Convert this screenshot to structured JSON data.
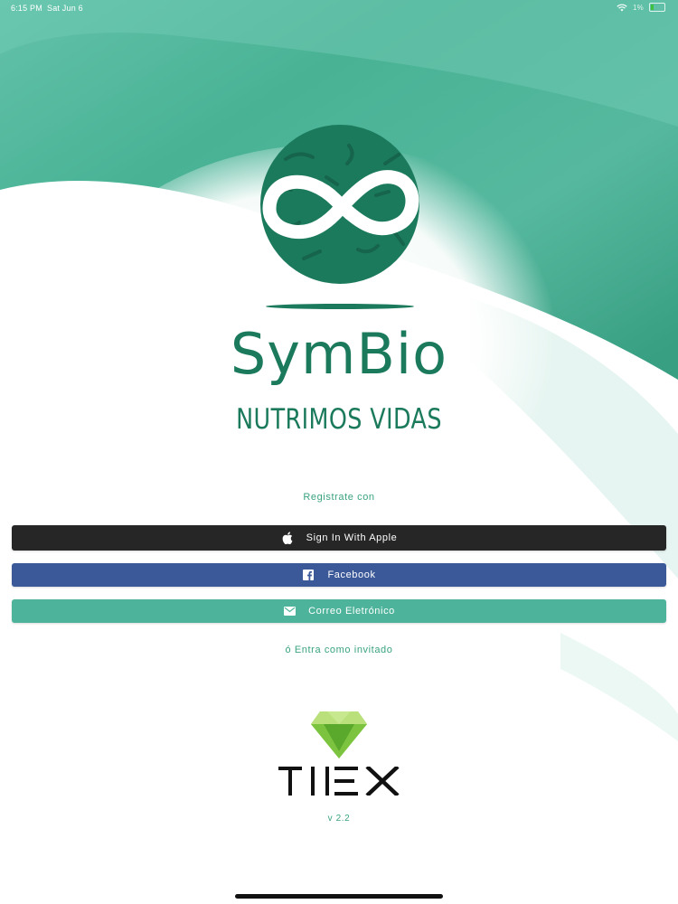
{
  "status_bar": {
    "time": "6:15 PM",
    "date": "Sat Jun 6",
    "battery_percent": "1%",
    "icons": [
      "wifi-icon",
      "battery-icon"
    ]
  },
  "brand": {
    "name": "SymBio",
    "tagline": "NUTRIMOS VIDAS",
    "logo_icon": "infinity-globe-icon"
  },
  "auth": {
    "register_label": "Registrate con",
    "buttons": [
      {
        "label": "Sign In With Apple",
        "icon": "apple-icon",
        "color": "#262626"
      },
      {
        "label": "Facebook",
        "icon": "facebook-icon",
        "color": "#3b5998"
      },
      {
        "label": "Correo Eletrónico",
        "icon": "mail-icon",
        "color": "#4db39a"
      }
    ],
    "guest_link": "ó Entra como invitado"
  },
  "footer": {
    "company": "TIEX",
    "gem_icon": "gem-icon",
    "version": "v 2.2"
  },
  "colors": {
    "brand_green": "#1b7a5c",
    "accent_teal": "#4db39a",
    "link_green": "#3aa37f"
  }
}
